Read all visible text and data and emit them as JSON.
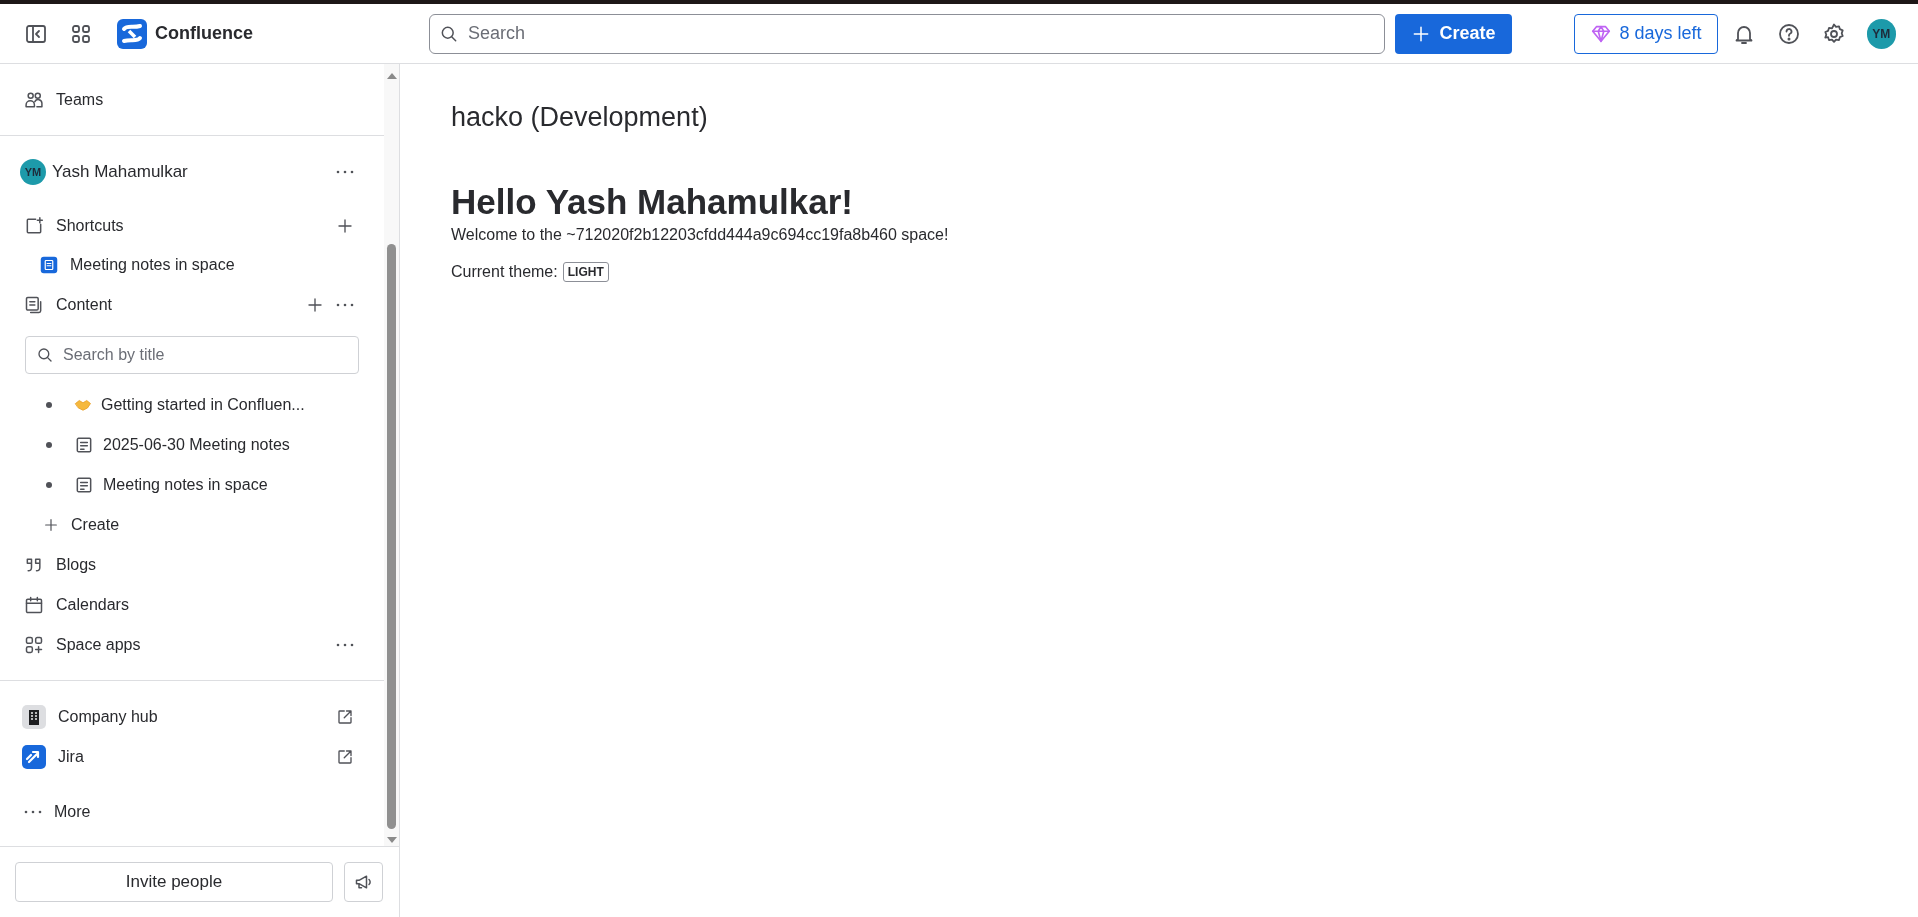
{
  "topbar": {
    "product": "Confluence",
    "search": {
      "placeholder": "Search"
    },
    "create_button": "Create",
    "trial_badge": "8 days left",
    "avatar": "YM"
  },
  "sidebar": {
    "teams": "Teams",
    "space_owner": {
      "initials": "YM",
      "name": "Yash Mahamulkar"
    },
    "shortcuts": {
      "label": "Shortcuts",
      "items": [
        {
          "label": "Meeting notes in space"
        }
      ]
    },
    "content": {
      "label": "Content",
      "filter": {
        "placeholder": "Search by title"
      },
      "pages": [
        {
          "title": "Getting started in Confluen...",
          "kind": "emoji"
        },
        {
          "title": "2025-06-30 Meeting notes",
          "kind": "page"
        },
        {
          "title": "Meeting notes in space",
          "kind": "page"
        }
      ],
      "create": "Create"
    },
    "blogs": "Blogs",
    "calendars": "Calendars",
    "space_apps": "Space apps",
    "external_links": [
      {
        "label": "Company hub",
        "kind": "hub"
      },
      {
        "label": "Jira",
        "kind": "jira"
      }
    ],
    "more": "More",
    "invite_button": "Invite people"
  },
  "main": {
    "space_title": "hacko (Development)",
    "heading": "Hello Yash Mahamulkar!",
    "welcome": "Welcome to the ~712020f2b12203cfdd444a9c694cc19fa8b460 space!",
    "theme_label": "Current theme:",
    "theme_value": "LIGHT"
  }
}
